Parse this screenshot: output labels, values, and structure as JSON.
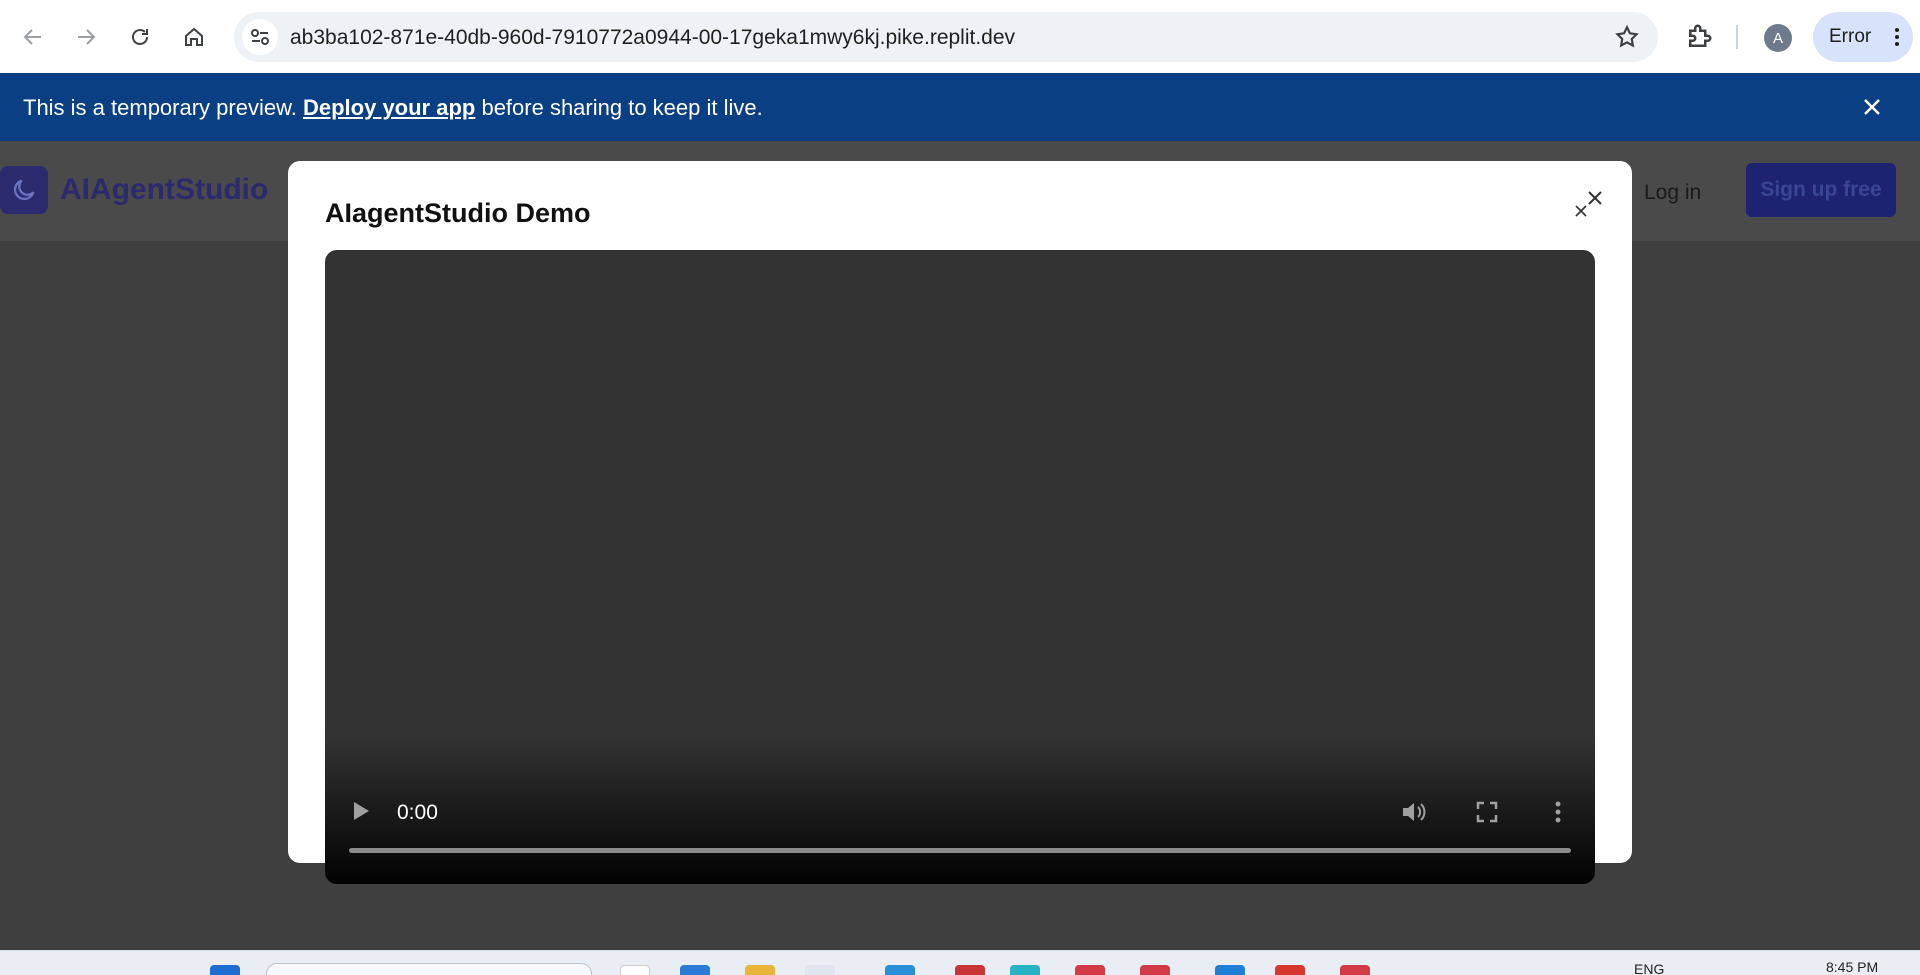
{
  "browser": {
    "url": "ab3ba102-871e-40db-960d-7910772a0944-00-17geka1mwy6kj.pike.replit.dev",
    "profile_initial": "A",
    "status_chip": "Error"
  },
  "banner": {
    "text_before": "This is a temporary preview. ",
    "link": "Deploy your app",
    "text_after": " before sharing to keep it live.",
    "bg_color": "#0a3f84"
  },
  "app": {
    "name": "AIAgentStudio",
    "login_label": "Log in",
    "signup_label": "Sign up free"
  },
  "modal": {
    "title": "AIagentStudio Demo",
    "video": {
      "time": "0:00",
      "progress": 0
    }
  },
  "taskbar": {
    "lang": "ENG",
    "time": "8:45 PM"
  }
}
